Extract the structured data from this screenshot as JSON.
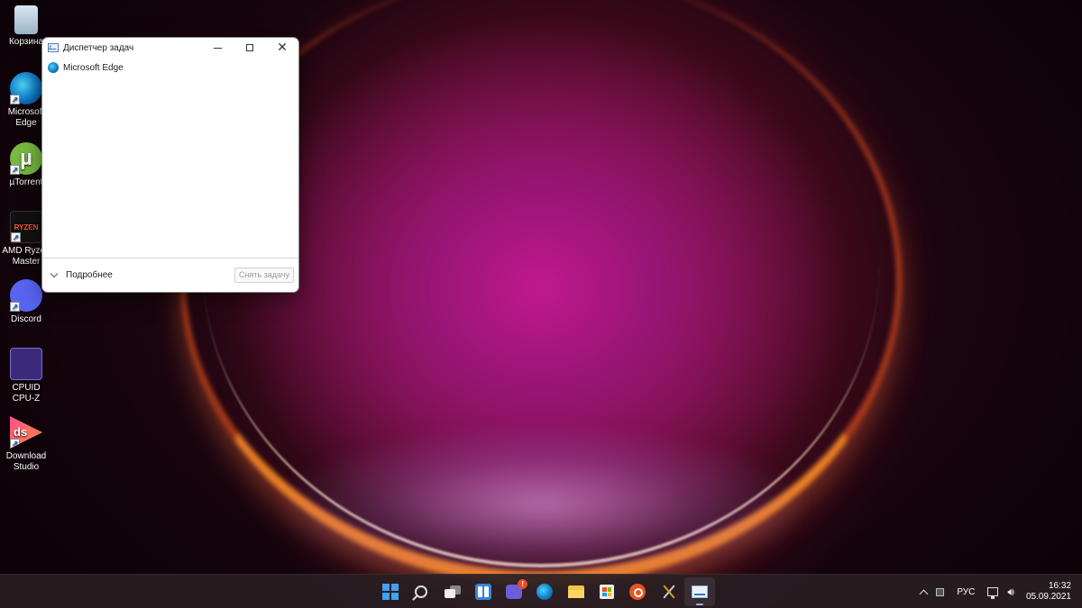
{
  "desktop": {
    "icons": [
      {
        "label": "Корзина",
        "icon": "recycle-bin-icon"
      },
      {
        "label": "Microsoft Edge",
        "icon": "edge-icon"
      },
      {
        "label": "µTorrent",
        "icon": "utorrent-icon"
      },
      {
        "label": "AMD Ryzen Master",
        "icon": "ryzen-master-icon"
      },
      {
        "label": "Discord",
        "icon": "discord-icon"
      },
      {
        "label": "CPUID CPU-Z",
        "icon": "cpuz-icon"
      },
      {
        "label": "Download Studio",
        "icon": "download-studio-icon"
      }
    ]
  },
  "window": {
    "title": "Диспетчер задач",
    "processes": [
      {
        "name": "Microsoft Edge",
        "icon": "edge-icon"
      }
    ],
    "more_label": "Подробнее",
    "end_task_label": "Снять задачу"
  },
  "taskbar": {
    "apps": [
      "start",
      "search",
      "task-view",
      "widgets",
      "chat",
      "edge",
      "file-explorer",
      "store",
      "ubuntu",
      "tool",
      "task-manager"
    ],
    "chat_badge": "!",
    "tray": {
      "language": "РУС",
      "time": "16:32",
      "date": "05.09.2021"
    }
  },
  "colors": {
    "accent": "#3fa2f0",
    "wallpaper_center": "#c0188f",
    "ring": "#ff8c28"
  }
}
